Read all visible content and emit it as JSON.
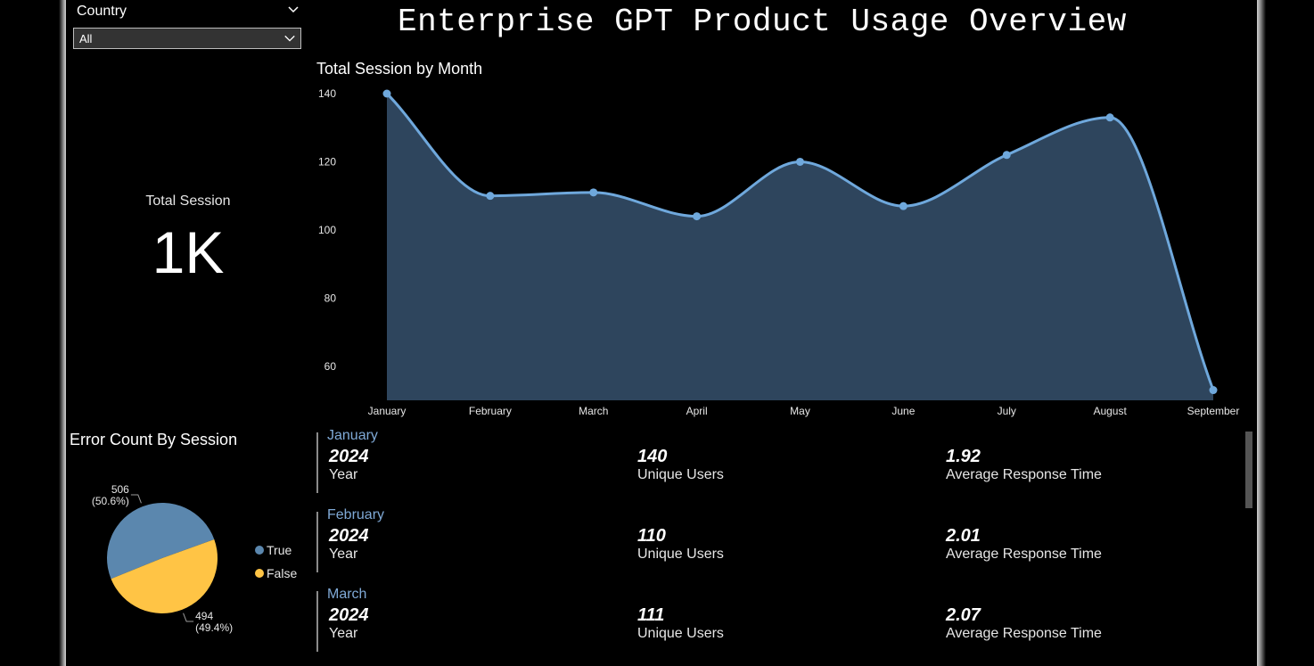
{
  "filter": {
    "title": "Country",
    "selected": "All"
  },
  "page_title": "Enterprise GPT Product Usage Overview",
  "kpi": {
    "label": "Total Session",
    "value": "1K"
  },
  "chart_data": [
    {
      "type": "area",
      "title": "Total Session by Month",
      "categories": [
        "January",
        "February",
        "March",
        "April",
        "May",
        "June",
        "July",
        "August",
        "September"
      ],
      "values": [
        140,
        110,
        111,
        104,
        120,
        107,
        122,
        133,
        53
      ],
      "ylim": [
        50,
        140
      ],
      "yticks": [
        140,
        120,
        100,
        80,
        60
      ],
      "xlabel": "",
      "ylabel": "",
      "grid": false,
      "colors": {
        "line": "#6fa8dc",
        "fill": "#2e455d"
      }
    },
    {
      "type": "pie",
      "title": "Error Count By Session",
      "slices": [
        {
          "name": "True",
          "value": 506,
          "label": "506",
          "pct_label": "(50.6%)",
          "color": "#5b87ae"
        },
        {
          "name": "False",
          "value": 494,
          "label": "494",
          "pct_label": "(49.4%)",
          "color": "#ffc445"
        }
      ],
      "legend_position": "right"
    }
  ],
  "cards": [
    {
      "month": "January",
      "year": "2024",
      "year_label": "Year",
      "users": "140",
      "users_label": "Unique Users",
      "response": "1.92",
      "response_label": "Average Response Time"
    },
    {
      "month": "February",
      "year": "2024",
      "year_label": "Year",
      "users": "110",
      "users_label": "Unique Users",
      "response": "2.01",
      "response_label": "Average Response Time"
    },
    {
      "month": "March",
      "year": "2024",
      "year_label": "Year",
      "users": "111",
      "users_label": "Unique Users",
      "response": "2.07",
      "response_label": "Average Response Time"
    }
  ]
}
